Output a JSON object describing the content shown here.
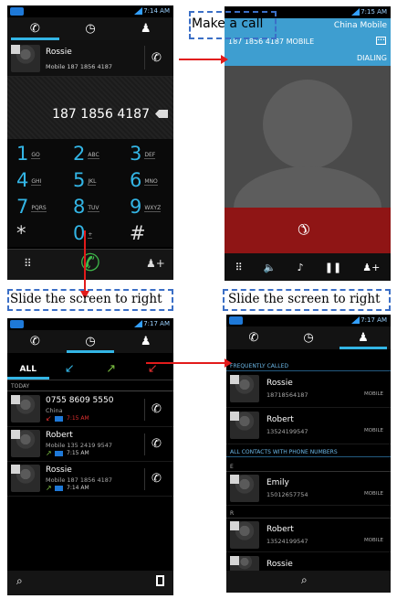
{
  "screen1": {
    "status_time": "7:14 AM",
    "contact": {
      "name": "Rossie",
      "detail": "Mobile 187 1856 4187"
    },
    "dialed_number": "187 1856 4187",
    "keys": [
      {
        "d": "1",
        "l": "GO"
      },
      {
        "d": "2",
        "l": "ABC"
      },
      {
        "d": "3",
        "l": "DEF"
      },
      {
        "d": "4",
        "l": "GHI"
      },
      {
        "d": "5",
        "l": "JKL"
      },
      {
        "d": "6",
        "l": "MNO"
      },
      {
        "d": "7",
        "l": "PQRS"
      },
      {
        "d": "8",
        "l": "TUV"
      },
      {
        "d": "9",
        "l": "WXYZ"
      },
      {
        "d": "*",
        "l": ""
      },
      {
        "d": "0",
        "l": "+"
      },
      {
        "d": "#",
        "l": ""
      }
    ]
  },
  "screen2": {
    "status_time": "7:15 AM",
    "carrier": "China Mobile",
    "number_line": "187 1856 4187 MOBILE",
    "state": "DIALING"
  },
  "screen3": {
    "status_time": "7:17 AM",
    "filter_all": "ALL",
    "section": "TODAY",
    "calls": [
      {
        "name": "0755 8609 5550",
        "detail": "China",
        "time": "7:15 AM",
        "missed": true
      },
      {
        "name": "Robert",
        "detail": "Mobile 135 2419 9547",
        "time": "7:15 AM",
        "missed": false
      },
      {
        "name": "Rossie",
        "detail": "Mobile 187 1856 4187",
        "time": "7:14 AM",
        "missed": false
      }
    ]
  },
  "screen4": {
    "status_time": "7:17 AM",
    "frequent_header": "FREQUENTLY CALLED",
    "frequent": [
      {
        "name": "Rossie",
        "number": "18718564187",
        "type": "MOBILE"
      },
      {
        "name": "Robert",
        "number": "13524199547",
        "type": "MOBILE"
      }
    ],
    "all_header": "ALL CONTACTS WITH PHONE NUMBERS",
    "letter_e": "E",
    "contact_e": {
      "name": "Emily",
      "number": "15012657754",
      "type": "MOBILE"
    },
    "letter_r": "R",
    "contact_r": {
      "name": "Robert",
      "number": "13524199547",
      "type": "MOBILE"
    },
    "contact_cut": "Rossie"
  },
  "captions": {
    "make_call": "Make a call",
    "slide_left": "Slide the screen to right",
    "slide_right": "Slide the screen to right"
  },
  "colors": {
    "accent": "#33b5e5",
    "arrow": "#e21b1b",
    "dash": "#3b6fc6"
  }
}
